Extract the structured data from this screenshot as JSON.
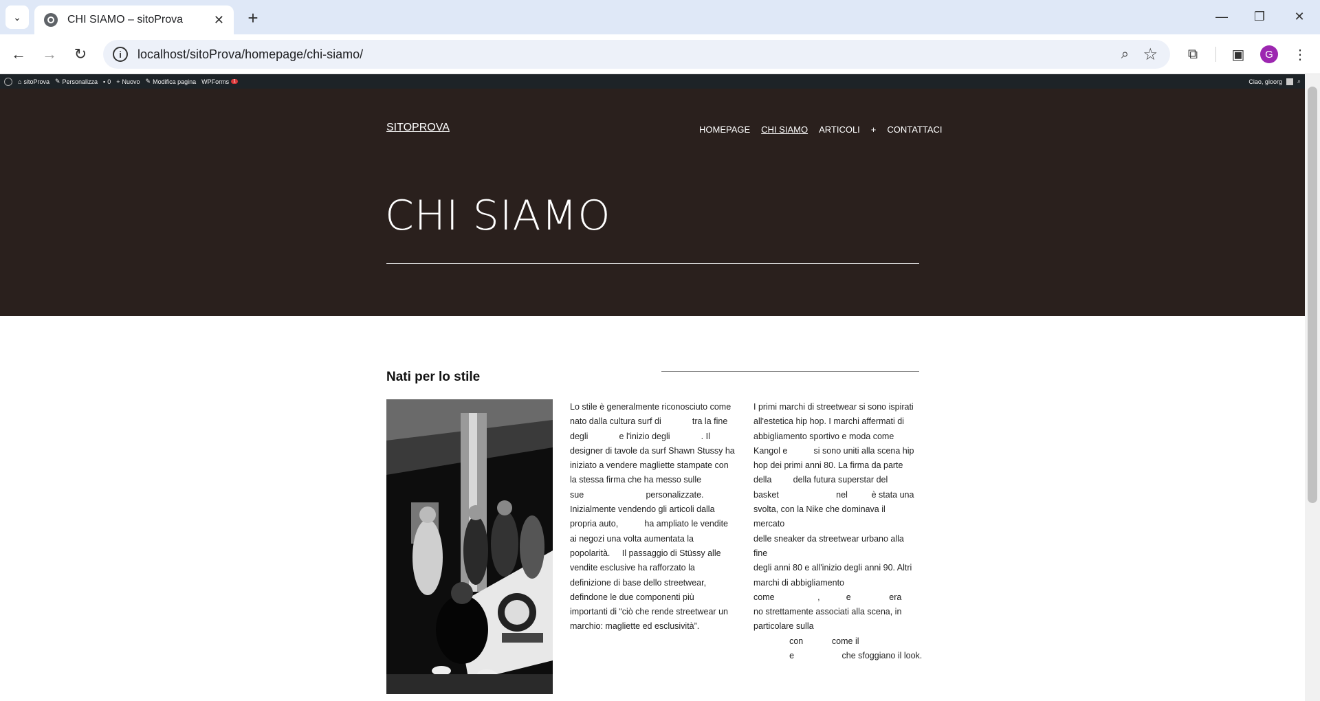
{
  "browser": {
    "tab_title": "CHI SIAMO – sitoProva",
    "url": "localhost/sitoProva/homepage/chi-siamo/",
    "profile_initial": "G"
  },
  "adminbar": {
    "site": "sitoProva",
    "customize": "Personalizza",
    "comments": "0",
    "new": "Nuovo",
    "edit": "Modifica pagina",
    "wpforms": "WPForms",
    "wpforms_badge": "1",
    "greeting": "Ciao, gioorg"
  },
  "site": {
    "title": "SITOPROVA",
    "nav": [
      "HOMEPAGE",
      "CHI SIAMO",
      "ARTICOLI",
      "+",
      "CONTATTACI"
    ],
    "page_title": "CHI SIAMO"
  },
  "content": {
    "section_title": "Nati per lo stile",
    "col1": [
      "Lo stile è generalmente riconosciuto come",
      "nato dalla cultura surf di             tra la fine",
      "degli             e l'inizio degli             . Il",
      "designer di tavole da surf Shawn Stussy ha",
      "iniziato a vendere magliette stampate con",
      "la stessa firma che ha messo sulle",
      "sue                          personalizzate.",
      "Inizialmente vendendo gli articoli dalla",
      "propria auto,           ha ampliato le vendite",
      "ai negozi una volta aumentata la",
      "popolarità.     Il passaggio di Stüssy alle",
      "vendite esclusive ha rafforzato la",
      "definizione di base dello streetwear,",
      "defindone le due componenti più",
      "importanti di “ciò che rende streetwear un",
      "marchio: magliette ed esclusività”."
    ],
    "col2": [
      "I primi marchi di streetwear si sono ispirati",
      "all'estetica hip hop. I marchi affermati di",
      "abbigliamento sportivo e moda come",
      "Kangol e           si sono uniti alla scena hip",
      "hop dei primi anni 80. La firma da parte",
      "della         della futura superstar del",
      "basket                        nel          è stata una",
      "svolta, con la Nike che dominava il mercato",
      "delle sneaker da streetwear urbano alla fine",
      "degli anni 80 e all'inizio degli anni 90. Altri",
      "marchi di abbigliamento",
      "come                  ,           e                era",
      "no strettamente associati alla scena, in",
      "particolare sulla",
      "               con            come il",
      "               e                    che sfoggiano il look."
    ]
  },
  "colors": {
    "hero_bg": "#2a201d",
    "adminbar_bg": "#1d2327",
    "tabstrip_bg": "#dfe8f7",
    "avatar": "#9c27b0"
  }
}
